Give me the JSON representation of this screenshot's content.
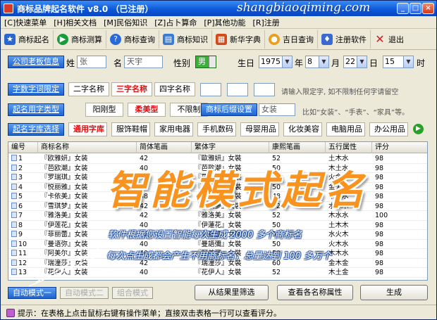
{
  "window": {
    "title": "商标品牌起名软件 v8.0 （已注册）",
    "watermark": "shangbiaoqiming.com"
  },
  "menu": [
    "[C]快速菜单",
    "[H]相关文档",
    "[M]民俗知识",
    "[Z]占卜算命",
    "[P]其他功能",
    "[R]注册"
  ],
  "toolbar": [
    {
      "label": "商标起名",
      "icon": "naming-icon",
      "color": "#2a66d0"
    },
    {
      "label": "商标测算",
      "icon": "calc-icon",
      "color": "#1a9a3a"
    },
    {
      "label": "商标查询",
      "icon": "help-icon",
      "color": "#2a6ad8"
    },
    {
      "label": "商标知识",
      "icon": "book-icon",
      "color": "#3a7ad0"
    },
    {
      "label": "新华字典",
      "icon": "dictionary-icon",
      "color": "#d04a1a"
    },
    {
      "label": "吉日查询",
      "icon": "calendar-icon",
      "color": "#e8a020"
    },
    {
      "label": "注册软件",
      "icon": "shield-icon",
      "color": "#3a6ad0"
    },
    {
      "label": "退出",
      "icon": "exit-icon",
      "color": "#d02020"
    }
  ],
  "company": {
    "button": "公司老板信息",
    "surname_label": "姓",
    "surname": "张",
    "name_label": "名",
    "name": "天宇",
    "gender_label": "性别",
    "gender": "男",
    "birthday_label": "生日",
    "year": "1975",
    "year_unit": "年",
    "month": "8",
    "month_unit": "月",
    "day": "22",
    "day_unit": "日",
    "hour": "15",
    "hour_unit": "时"
  },
  "char_limit": {
    "button": "字数字词限定",
    "options": [
      "二字名称",
      "三字名称",
      "四字名称"
    ],
    "selected": "三字名称",
    "hint": "请输入限定字, 如不限制任何字请留空"
  },
  "style": {
    "button": "起名用字类型",
    "options": [
      "阳刚型",
      "柔美型",
      "不限制"
    ],
    "selected": "柔美型",
    "suffix_button": "商标后缀设置",
    "suffix_value": "女装",
    "suffix_hint": "比如“女装”、“手表”、“家具”等。"
  },
  "library": {
    "button": "起名字库选择",
    "options": [
      "通用字库",
      "服饰鞋帽",
      "家用电器",
      "手机数码",
      "母婴用品",
      "化妆美容",
      "电脑用品",
      "办公用品"
    ],
    "selected": "通用字库"
  },
  "grid": {
    "columns": [
      "编号",
      "商标名称",
      "简体笔画",
      "繁体字",
      "康熙笔画",
      "五行属性",
      "评分"
    ],
    "rows": [
      [
        "1",
        "『欧雅妍』女装",
        "42",
        "『歐雅妍』女裝",
        "52",
        "土木水",
        "98"
      ],
      [
        "2",
        "『芭欧潮』女装",
        "40",
        "『芭歐潮』女裝",
        "50",
        "木土水",
        "98"
      ],
      [
        "3",
        "『罗瑞琪』女装",
        "42",
        "『羅瑞琪』女裝",
        "52",
        "火金木",
        "98"
      ],
      [
        "4",
        "『悦丽雅』女装",
        "40",
        "『悅麗雅』女裝",
        "50",
        "金火木",
        "98"
      ],
      [
        "5",
        "『卡依美』女装",
        "38",
        "『卡依美』女裝",
        "48",
        "木土水",
        "98"
      ],
      [
        "6",
        "『雪琪梦』女装",
        "42",
        "『雪琪夢』女裝",
        "52",
        "水木木",
        "98"
      ],
      [
        "7",
        "『雅洛美』女装",
        "42",
        "『雅洛美』女裝",
        "52",
        "木水水",
        "100"
      ],
      [
        "8",
        "『伊莲花』女装",
        "40",
        "『伊蓮花』女裝",
        "50",
        "土木木",
        "98"
      ],
      [
        "9",
        "『菲丽蕾』女装",
        "42",
        "『菲麗蕾』女裝",
        "52",
        "水火木",
        "98"
      ],
      [
        "10",
        "『曼语弥』女装",
        "40",
        "『曼語彌』女裝",
        "50",
        "火木水",
        "98"
      ],
      [
        "11",
        "『阿美尔』女装",
        "40",
        "『阿美爾』女裝",
        "50",
        "木木水",
        "98"
      ],
      [
        "12",
        "『瑞潼莎』女装",
        "42",
        "『瑞潼莎』女裝",
        "60",
        "金木金",
        "98"
      ],
      [
        "13",
        "『花伊人』女装",
        "40",
        "『花伊人』女裝",
        "52",
        "木土金",
        "98"
      ]
    ]
  },
  "overlay": {
    "headline": "智能模式起名",
    "line1": "软件根据您设置智能每次生成 2000 多个商标名",
    "line2": "每次点生成都会产生不用商标名，总量达到 100 多万个"
  },
  "modes": [
    "自动模式一",
    "自动模式二",
    "组合模式"
  ],
  "actions": {
    "filter": "从结果里筛选",
    "attributes": "查看各名称属性",
    "generate": "生成"
  },
  "status": "提示：在表格上点击鼠标右键有操作菜单；直接双击表格一行可以查看评分。"
}
